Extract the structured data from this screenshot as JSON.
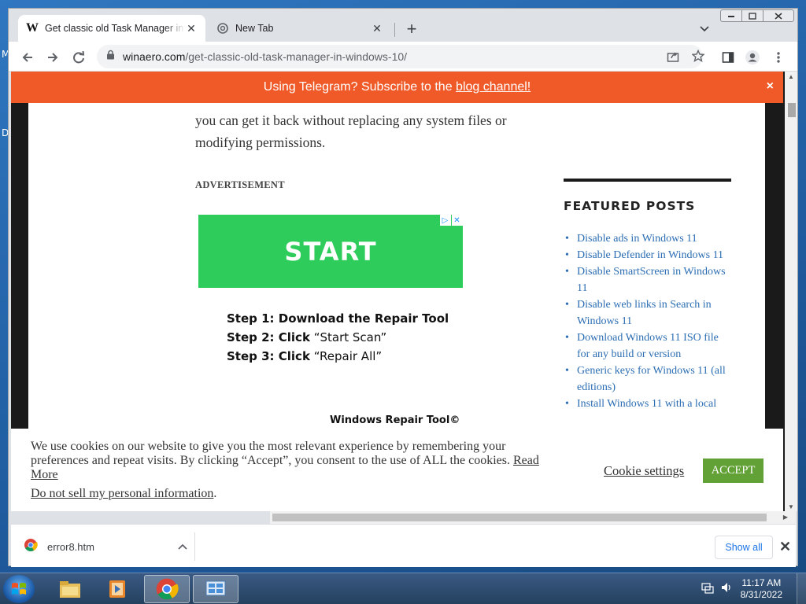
{
  "browser": {
    "tabs": [
      {
        "title": "Get classic old Task Manager in W",
        "active": true,
        "favicon": "W"
      },
      {
        "title": "New Tab",
        "active": false
      }
    ],
    "new_tab_symbol": "+",
    "url_host": "winaero.com",
    "url_path": "/get-classic-old-task-manager-in-windows-10/"
  },
  "telegram_bar": {
    "prefix": "Using Telegram? Subscribe to the ",
    "link": "blog channel!",
    "close": "×"
  },
  "article": {
    "text": "you can get it back without replacing any system files or modifying permissions."
  },
  "ad": {
    "label": "ADVERTISEMENT",
    "banner_label": "START",
    "steps": [
      {
        "bold": "Step 1: Download the Repair Tool",
        "plain": ""
      },
      {
        "bold": "Step 2: Click",
        "plain": " “Start Scan”"
      },
      {
        "bold": "Step 3: Click",
        "plain": " “Repair All”"
      }
    ],
    "footer": "Windows Repair Tool©"
  },
  "sidebar": {
    "title": "FEATURED POSTS",
    "posts": [
      "Disable ads in Windows 11",
      "Disable Defender in Windows 11",
      "Disable SmartScreen in Windows 11",
      "Disable web links in Search in Windows 11",
      "Download Windows 11 ISO file for any build or version",
      "Generic keys for Windows 11 (all editions)",
      "Install Windows 11 with a local"
    ]
  },
  "cookie_bar": {
    "message": "We use cookies on our website to give you the most relevant experience by remembering your preferences and repeat visits. By clicking “Accept”, you consent to the use of ALL the cookies.",
    "read_more": "Read More",
    "do_not_sell": "Do not sell my personal information",
    "do_not_sell_suffix": ".",
    "settings": "Cookie settings",
    "accept": "ACCEPT"
  },
  "downloads": {
    "file": "error8.htm",
    "show_all": "Show all"
  },
  "taskbar": {
    "time": "11:17 AM",
    "date": "8/31/2022"
  },
  "desktop": {
    "edge_letters": [
      "M",
      "D"
    ]
  },
  "colors": {
    "telegram_bar": "#f05a28",
    "ad_green": "#2ecc5a",
    "accept_green": "#62a135",
    "link_blue": "#2b6db3"
  }
}
